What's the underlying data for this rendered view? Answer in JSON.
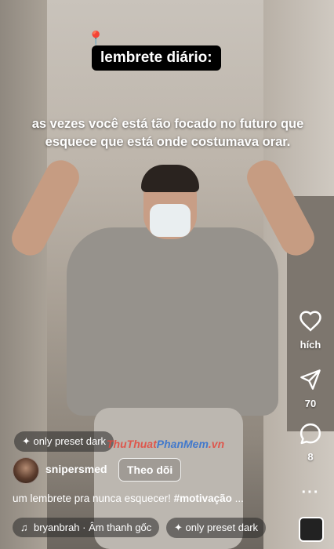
{
  "overlay": {
    "pin_emoji": "📍",
    "title": "lembrete diário:",
    "caption_line1": "as vezes você está tão focado no futuro que",
    "caption_line2": "esquece que está onde costumava orar."
  },
  "rail": {
    "like_label": "hích",
    "share_count": "70",
    "comment_count": "8",
    "more": "···"
  },
  "effect_top": "only preset dark",
  "account": {
    "username": "snipersmed",
    "follow_label": "Theo dõi"
  },
  "description": {
    "text": "um lembrete pra nunca esquecer! ",
    "hashtag": "#motivação",
    "ellipsis": " ..."
  },
  "audio": {
    "label": "bryanbrah · Âm thanh gốc"
  },
  "effect_bottom": "only preset dark",
  "watermark": {
    "part1": "ThuThuat",
    "part2": "PhanMem",
    "part3": ".vn"
  }
}
